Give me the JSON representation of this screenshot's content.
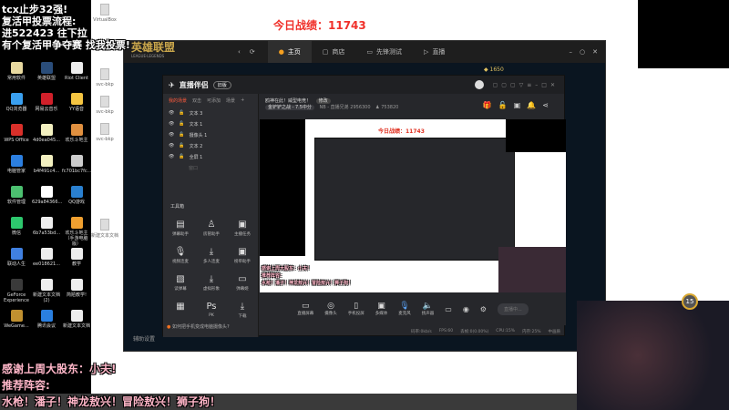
{
  "overlay": {
    "top_lines": [
      "tcx止步32强!",
      "复活甲投票流程:",
      "进522423 往下拉",
      "有个复活甲争夺赛 找我投票!"
    ],
    "score_label": "今日战绩：11743",
    "bottom_lines": [
      "感谢上周大股东：小夫!",
      "推荐阵容:",
      "水枪！潘子！神龙敖兴！冒险敖兴！狮子狗！"
    ]
  },
  "desktop": {
    "icons": [
      {
        "label": "常用软件",
        "color": "#e8d9a0"
      },
      {
        "label": "英雄联盟",
        "color": "#2a4d7a"
      },
      {
        "label": "Riot Client",
        "color": "#eee"
      },
      {
        "label": "QQ浏览器",
        "color": "#3aa0f0"
      },
      {
        "label": "网易云音乐",
        "color": "#d0202a"
      },
      {
        "label": "YY语音",
        "color": "#f5c542"
      },
      {
        "label": "WPS Office",
        "color": "#d9302a"
      },
      {
        "label": "4d0ea045...",
        "color": "#f3f0c0"
      },
      {
        "label": "欢乐斗地主",
        "color": "#e09040"
      },
      {
        "label": "电脑管家",
        "color": "#2c7fe0"
      },
      {
        "label": "b4f491c4...",
        "color": "#f3f0c0"
      },
      {
        "label": "fc701bc7fc...",
        "color": "#ccc"
      },
      {
        "label": "软件管理",
        "color": "#4cc070"
      },
      {
        "label": "629a84366...",
        "color": "#fff"
      },
      {
        "label": "QQ游戏",
        "color": "#2a80d0"
      },
      {
        "label": "微信",
        "color": "#2dc76d"
      },
      {
        "label": "6b7a53bd...",
        "color": "#eee"
      },
      {
        "label": "欢乐斗地主（手游电脑版）",
        "color": "#f0a030"
      },
      {
        "label": "联动人生",
        "color": "#4080e0"
      },
      {
        "label": "ee018621...",
        "color": "#eee"
      },
      {
        "label": "教学",
        "color": "#eee"
      },
      {
        "label": "GeForce Experience",
        "color": "#3a3a3a"
      },
      {
        "label": "新建文本文档(2)",
        "color": "#eee"
      },
      {
        "label": "简陋教学!",
        "color": "#eee"
      },
      {
        "label": "WeGame...",
        "color": "#c09030"
      },
      {
        "label": "腾讯会议",
        "color": "#2a7fe0"
      },
      {
        "label": "新建文本文档",
        "color": "#eee"
      }
    ],
    "files": [
      "VirtualBox",
      "svc-bkp",
      "svc-bkp",
      "svc-bkp",
      "新建文本文档"
    ]
  },
  "lol_client": {
    "logo": "英雄联盟",
    "logo_sub": "LEAGUE·LEGENDS",
    "tabs": [
      {
        "label": "主页",
        "icon": "home-icon"
      },
      {
        "label": "商店",
        "icon": "shop-icon"
      },
      {
        "label": "先锋测试",
        "icon": "test-icon"
      },
      {
        "label": "直播",
        "icon": "live-icon"
      }
    ],
    "currency": "1650",
    "footer": "辅助设置"
  },
  "streamer_app": {
    "title": "直播伴侣",
    "badge": "旧版",
    "stream_title": "鸥神在此！威型电竞！",
    "edit_label": "修改",
    "category": "金铲铲之战 - 7.5中分",
    "room_info": "NB - 直播兄弟 2956300",
    "viewers": "753820",
    "scene_tabs": [
      "我的场景",
      "双击",
      "可添加",
      "场景"
    ],
    "sources": [
      "文本 3",
      "文本 1",
      "摄像头 1",
      "文本 2",
      "全屏 1",
      "窗口"
    ],
    "toolbox_title": "工具箱",
    "tools": [
      "弹幕助手",
      "房管助手",
      "主播任务",
      "视频连麦",
      "多人连麦",
      "榜单助手",
      "读弹幕",
      "虚拟形象",
      "弹幕姬",
      "",
      "PK",
      "下载"
    ],
    "tip": "如何把手机变成电脑摄像头?",
    "bottom_tools": [
      "直播屏幕",
      "摄像头",
      "手机投屏",
      "多媒体",
      "麦克风",
      "扬声器"
    ],
    "live_button": "直播中...",
    "status": [
      "码率:0kb/s",
      "FPS:60",
      "丢帧:0(0.00%)",
      "CPU:15%",
      "内存:25%",
      "中画质"
    ],
    "preview": {
      "score": "今日战绩：11743",
      "bottom_lines": [
        "感谢上周大股东：小夫!",
        "推荐阵容:",
        "水枪！潘子！神龙敖兴！冒险敖兴！狮子狗！"
      ]
    }
  },
  "webcam": {
    "level": "15"
  }
}
